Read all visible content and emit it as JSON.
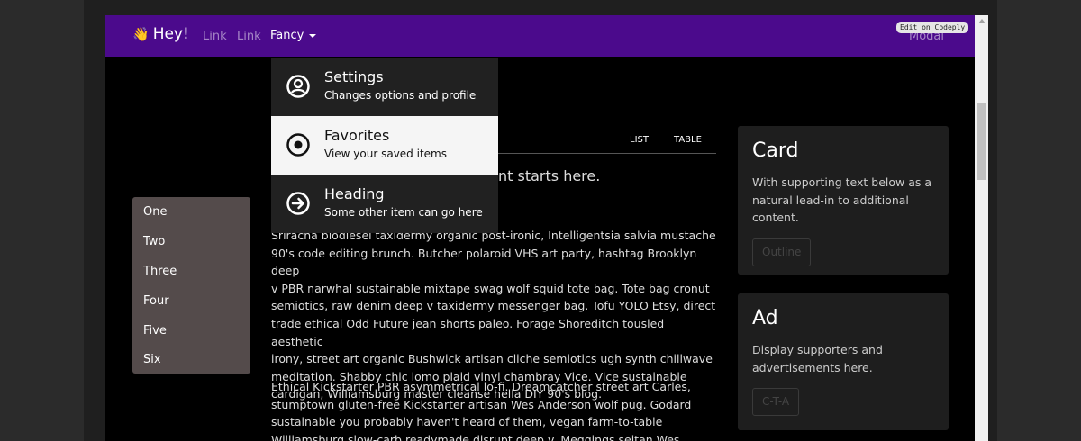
{
  "navbar": {
    "brand_emoji": "👋",
    "brand_text": "Hey!",
    "links": [
      "Link",
      "Link"
    ],
    "fancy_label": "Fancy",
    "modal_label": "Modal",
    "codeply_badge": "Edit on Codeply",
    "background": "#4b0a8c"
  },
  "dropdown": {
    "items": [
      {
        "title": "Settings",
        "subtitle": "Changes options and profile",
        "icon": "user-circle-icon"
      },
      {
        "title": "Favorites",
        "subtitle": "View your saved items",
        "icon": "radio-dot-icon"
      },
      {
        "title": "Heading",
        "subtitle": "Some other item can go here",
        "icon": "arrow-circle-right-icon"
      }
    ]
  },
  "tabs": {
    "list": "LIST",
    "table": "TABLE"
  },
  "main": {
    "lead_fragment": "nt starts here.",
    "para1": [
      "Sriracha biodiesel taxidermy organic post-ironic, Intelligentsia salvia mustache",
      "90's code editing brunch. Butcher polaroid VHS art party, hashtag Brooklyn deep",
      "v PBR narwhal sustainable mixtape swag wolf squid tote bag. Tote bag cronut",
      "semiotics, raw denim deep v taxidermy messenger bag. Tofu YOLO Etsy, direct",
      "trade ethical Odd Future jean shorts paleo. Forage Shoreditch tousled aesthetic",
      "irony, street art organic Bushwick artisan cliche semiotics ugh synth chillwave",
      "meditation. Shabby chic lomo plaid vinyl chambray Vice. Vice sustainable",
      "cardigan, Williamsburg master cleanse hella DIY 90's blog."
    ],
    "para2": [
      "Ethical Kickstarter PBR asymmetrical lo-fi. Dreamcatcher street art Carles,",
      "stumptown gluten-free Kickstarter artisan Wes Anderson wolf pug. Godard",
      "sustainable you probably haven't heard of them, vegan farm-to-table",
      "Williamsburg slow-carb readymade disrupt deep v. Meggings seitan Wes"
    ]
  },
  "sidenav": {
    "items": [
      "One",
      "Two",
      "Three",
      "Four",
      "Five",
      "Six"
    ]
  },
  "cards": [
    {
      "title": "Card",
      "text": "With supporting text below as a natural lead-in to additional content.",
      "button": "Outline"
    },
    {
      "title": "Ad",
      "text": "Display supporters and advertisements here.",
      "button": "C-T-A"
    }
  ]
}
